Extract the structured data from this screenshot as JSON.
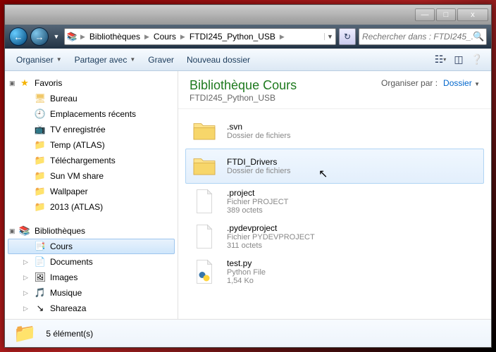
{
  "titlebar": {
    "min": "—",
    "max": "□",
    "close": "x"
  },
  "nav": {
    "back": "←",
    "fwd": "→",
    "hist": "▼",
    "refresh": "↻"
  },
  "breadcrumb": {
    "parts": [
      "Bibliothèques",
      "Cours",
      "FTDI245_Python_USB"
    ]
  },
  "search": {
    "placeholder": "Rechercher dans : FTDI245_...",
    "icon": "🔍"
  },
  "toolbar": {
    "organize": "Organiser",
    "share": "Partager avec",
    "burn": "Graver",
    "newfolder": "Nouveau dossier"
  },
  "sidebar": {
    "favorites": {
      "label": "Favoris",
      "items": [
        {
          "icon": "🖥",
          "label": "Bureau"
        },
        {
          "icon": "🕘",
          "label": "Emplacements récents"
        },
        {
          "icon": "📺",
          "label": "TV enregistrée"
        },
        {
          "icon": "📁",
          "label": "Temp (ATLAS)"
        },
        {
          "icon": "📁",
          "label": "Téléchargements"
        },
        {
          "icon": "📁",
          "label": "Sun VM share"
        },
        {
          "icon": "📁",
          "label": "Wallpaper"
        },
        {
          "icon": "📁",
          "label": "2013 (ATLAS)"
        }
      ]
    },
    "libraries": {
      "label": "Bibliothèques",
      "items": [
        {
          "icon": "📑",
          "label": "Cours",
          "selected": true
        },
        {
          "icon": "📄",
          "label": "Documents"
        },
        {
          "icon": "🖼",
          "label": "Images"
        },
        {
          "icon": "🎵",
          "label": "Musique"
        },
        {
          "icon": "↘",
          "label": "Shareaza"
        }
      ]
    }
  },
  "main": {
    "title": "Bibliothèque Cours",
    "subtitle": "FTDI245_Python_USB",
    "arrange_label": "Organiser par :",
    "arrange_value": "Dossier",
    "items": [
      {
        "type": "folder",
        "name": ".svn",
        "meta1": "Dossier de fichiers",
        "meta2": ""
      },
      {
        "type": "folder",
        "name": "FTDI_Drivers",
        "meta1": "Dossier de fichiers",
        "meta2": "",
        "hovered": true
      },
      {
        "type": "file",
        "name": ".project",
        "meta1": "Fichier PROJECT",
        "meta2": "389 octets"
      },
      {
        "type": "file",
        "name": ".pydevproject",
        "meta1": "Fichier PYDEVPROJECT",
        "meta2": "311 octets"
      },
      {
        "type": "python",
        "name": "test.py",
        "meta1": "Python File",
        "meta2": "1,54 Ko"
      }
    ]
  },
  "status": {
    "count": "5 élément(s)"
  }
}
